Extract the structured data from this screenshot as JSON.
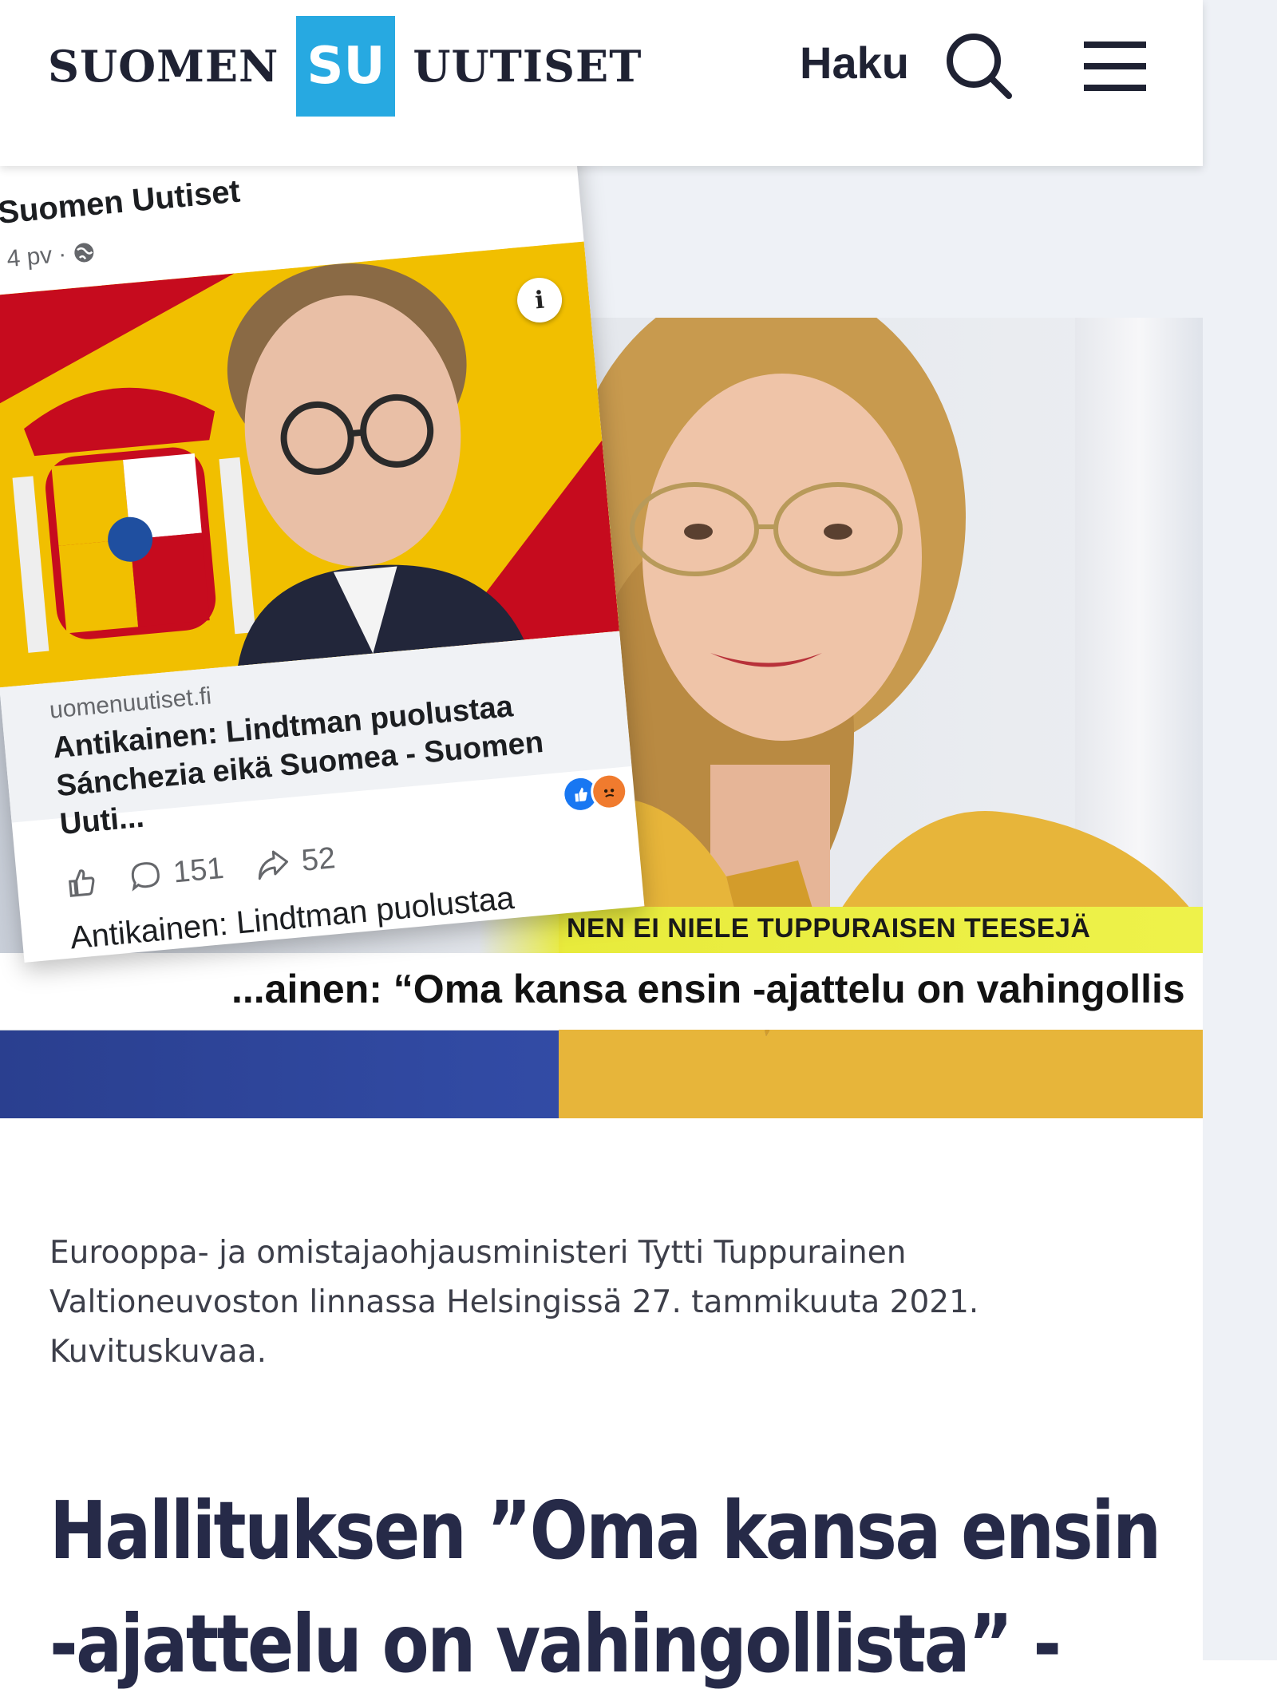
{
  "header": {
    "brand_left": "SUOMEN",
    "brand_box": "SU",
    "brand_right": "UUTISET",
    "search_label": "Haku",
    "icons": [
      "search-icon",
      "menu-icon"
    ],
    "accent_color": "#27a9e1"
  },
  "facebook_post": {
    "page_name": "Suomen Uutiset",
    "age": "4 pv",
    "link_domain": "uomenuutiset.fi",
    "link_title": "Antikainen: Lindtman puolustaa Sánchezia eikä Suomea - Suomen Uuti...",
    "comments_count": "151",
    "shares_count": "52",
    "caption": "Antikainen: Lindtman puolustaa Sánchezia eikä Suomea",
    "reactions": [
      "like",
      "angry"
    ]
  },
  "hero": {
    "ticker_top": "NEN EI NIELE TUPPURAISEN TEESEJÄ",
    "ticker_bottom": "...ainen: “Oma kansa ensin -ajattelu on vahingollis"
  },
  "article": {
    "photo_caption": "Eurooppa- ja omistajaohjausministeri Tytti Tuppurainen Valtioneuvoston linnassa Helsingissä 27. tammikuuta 2021. Kuvituskuvaa.",
    "title_line1": "Hallituksen ”Oma kansa ensin",
    "title_line2": "-ajattelu on vahingollista” -"
  }
}
